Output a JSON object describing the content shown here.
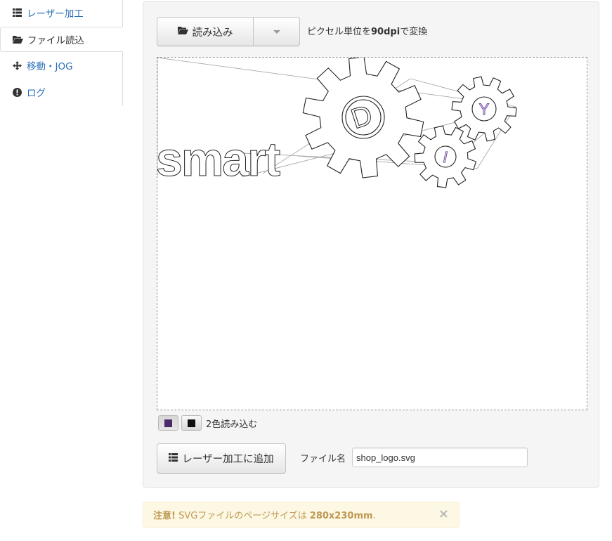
{
  "sidebar": {
    "items": [
      {
        "label": "レーザー加工",
        "icon": "list-icon"
      },
      {
        "label": "ファイル読込",
        "icon": "folder-open-icon",
        "active": true
      },
      {
        "label": "移動・JOG",
        "icon": "move-arrows-icon"
      },
      {
        "label": "ログ",
        "icon": "exclamation-circle-icon"
      }
    ]
  },
  "toolbar": {
    "load_label": "読み込み",
    "dpi_prefix": "ピクセル単位を",
    "dpi_value": "90dpi",
    "dpi_suffix": "で変換"
  },
  "preview": {
    "logo_text": "smart",
    "gear_letters": [
      "D",
      "Y",
      "I"
    ],
    "colors": {
      "path": "#222222",
      "guide": "#999999",
      "accent": "#6b3fa0"
    }
  },
  "colors": {
    "swatch1": "#4a2a6a",
    "swatch2": "#111111",
    "label": "2色読み込む"
  },
  "actions": {
    "add_label": "レーザー加工に追加",
    "filename_label": "ファイル名",
    "filename_value": "shop_logo.svg"
  },
  "alert": {
    "strong": "注意!",
    "text": " SVGファイルのページサイズは ",
    "size": "280x230mm",
    "tail": ".",
    "close": "×"
  }
}
